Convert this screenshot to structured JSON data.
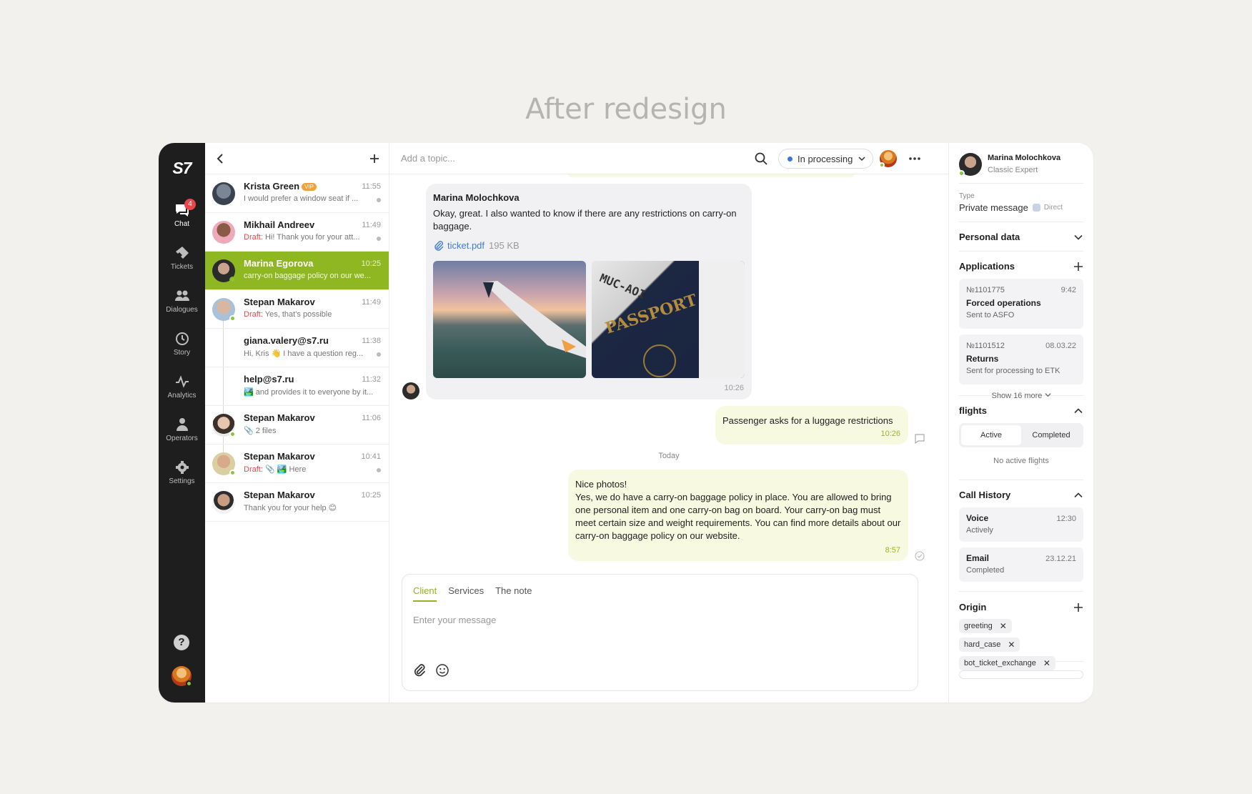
{
  "headline": "After redesign",
  "nav": {
    "logo": "S7",
    "items": [
      {
        "label": "Chat",
        "icon": "chat-icon",
        "badge": "4"
      },
      {
        "label": "Tickets",
        "icon": "ticket-icon"
      },
      {
        "label": "Dialogues",
        "icon": "people-icon"
      },
      {
        "label": "Story",
        "icon": "history-icon"
      },
      {
        "label": "Analytics",
        "icon": "analytics-icon"
      },
      {
        "label": "Operators",
        "icon": "person-icon"
      },
      {
        "label": "Settings",
        "icon": "gear-icon"
      }
    ],
    "help": "?"
  },
  "list": {
    "rows": [
      {
        "name": "Krista Green",
        "vip": "VIP",
        "time": "11:55",
        "preview": "I would prefer a window seat if ..."
      },
      {
        "name": "Mikhail Andreev",
        "time": "11:49",
        "draft": "Draft:",
        "preview": " Hi! Thank you for your att..."
      },
      {
        "name": "Marina Egorova",
        "time": "10:25",
        "preview": "carry-on baggage policy on our we..."
      },
      {
        "name": "Stepan Makarov",
        "time": "11:49",
        "draft": "Draft:",
        "preview": " Yes, that’s possible"
      },
      {
        "name": "giana.valery@s7.ru",
        "time": "11:38",
        "preview": "Hi, Kris 👋 I have a question reg..."
      },
      {
        "name": "help@s7.ru",
        "time": "11:32",
        "preview": "🏞️ and provides it to everyone by it..."
      },
      {
        "name": "Stepan Makarov",
        "time": "11:06",
        "preview": "📎 2 files"
      },
      {
        "name": "Stepan Makarov",
        "time": "10:41",
        "draft": "Draft:",
        "preview": " 📎 🏞️ Here"
      },
      {
        "name": "Stepan Makarov",
        "time": "10:25",
        "preview": "Thank you for your help 😊"
      }
    ]
  },
  "chat": {
    "topic_placeholder": "Add a topic...",
    "status": "In processing",
    "incoming": {
      "author": "Marina Molochkova",
      "text": "Okay, great. I also wanted to know if there are any restrictions on carry-on baggage.",
      "file": "ticket.pdf",
      "file_size": "195 KB",
      "time": "10:26"
    },
    "note": {
      "text": "Passenger asks for a luggage restrictions",
      "time": "10:26"
    },
    "day": "Today",
    "outgoing": {
      "line1": "Nice photos!",
      "text": "Yes, we do have a carry-on baggage policy in place. You are allowed to bring one personal item and one carry-on bag on board. Your carry-on bag must meet certain size and weight requirements. You can find more details about our carry-on baggage policy on our website.",
      "time": "8:57"
    },
    "composer": {
      "tabs": [
        "Client",
        "Services",
        "The note"
      ],
      "placeholder": "Enter your message"
    }
  },
  "side": {
    "contact": {
      "name": "Marina Molochkova",
      "role": "Classic Expert"
    },
    "type_label": "Type",
    "type_value": "Private message",
    "type_extra": "Direct",
    "personal": "Personal data",
    "applications": {
      "title": "Applications",
      "items": [
        {
          "number": "№1101775",
          "time": "9:42",
          "title": "Forced operations",
          "status": "Sent to ASFO"
        },
        {
          "number": "№1101512",
          "time": "08.03.22",
          "title": "Returns",
          "status": "Sent for processing to ETK"
        }
      ],
      "more": "Show 16 more"
    },
    "flights": {
      "title": "flights",
      "tabs": [
        "Active",
        "Completed"
      ],
      "empty": "No active flights"
    },
    "calls": {
      "title": "Call History",
      "items": [
        {
          "type": "Voice",
          "time": "12:30",
          "status": "Actively"
        },
        {
          "type": "Email",
          "time": "23.12.21",
          "status": "Completed"
        }
      ]
    },
    "origin": {
      "title": "Origin",
      "tags": [
        "greeting",
        "hard_case",
        "bot_ticket_exchange"
      ]
    }
  }
}
